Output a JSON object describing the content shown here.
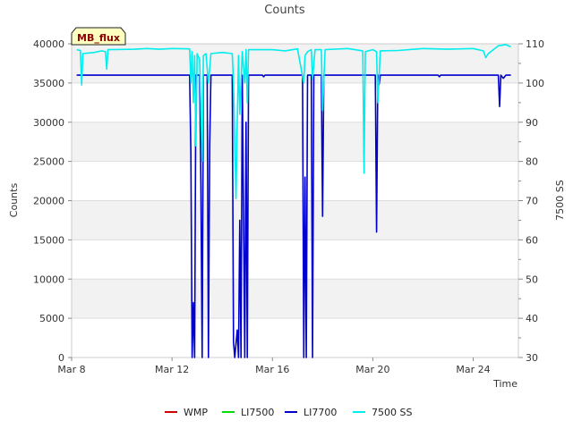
{
  "chart_data": {
    "type": "line",
    "title": "Counts",
    "xlabel": "Time",
    "ylabel": "Counts",
    "y2label": "7500 SS",
    "badge": "MB_flux",
    "ylim": [
      0,
      40000
    ],
    "y2lim": [
      30,
      110
    ],
    "xlim": [
      "2024-03-08",
      "2024-03-25.8"
    ],
    "x_ticks": [
      {
        "date": "2024-03-08",
        "label": "Mar 8"
      },
      {
        "date": "2024-03-12",
        "label": "Mar 12"
      },
      {
        "date": "2024-03-16",
        "label": "Mar 16"
      },
      {
        "date": "2024-03-20",
        "label": "Mar 20"
      },
      {
        "date": "2024-03-24",
        "label": "Mar 24"
      }
    ],
    "y_ticks": [
      {
        "value": 0,
        "label": "0"
      },
      {
        "value": 5000,
        "label": "5000"
      },
      {
        "value": 10000,
        "label": "10000"
      },
      {
        "value": 15000,
        "label": "15000"
      },
      {
        "value": 20000,
        "label": "20000"
      },
      {
        "value": 25000,
        "label": "25000"
      },
      {
        "value": 30000,
        "label": "30000"
      },
      {
        "value": 35000,
        "label": "35000"
      },
      {
        "value": 40000,
        "label": "40000"
      }
    ],
    "y2_ticks": [
      {
        "value": 30,
        "label": "30"
      },
      {
        "value": 40,
        "label": "40"
      },
      {
        "value": 50,
        "label": "50"
      },
      {
        "value": 60,
        "label": "60"
      },
      {
        "value": 70,
        "label": "70"
      },
      {
        "value": 80,
        "label": "80"
      },
      {
        "value": 90,
        "label": "90"
      },
      {
        "value": 100,
        "label": "100"
      },
      {
        "value": 110,
        "label": "110"
      }
    ],
    "legend_position": "bottom",
    "legend": [
      {
        "name": "WMP",
        "color": "#cc0000"
      },
      {
        "name": "LI7500",
        "color": "#00dd00"
      },
      {
        "name": "LI7700",
        "color": "#0000cc"
      },
      {
        "name": "7500 SS",
        "color": "#00eeee"
      }
    ],
    "series": [
      {
        "name": "LI7700",
        "axis": "left",
        "color": "#0000cc",
        "points": [
          [
            "2024-03-08.2",
            36000
          ],
          [
            "2024-03-12.7",
            36000
          ],
          [
            "2024-03-12.75",
            26000
          ],
          [
            "2024-03-12.8",
            0
          ],
          [
            "2024-03-12.85",
            7000
          ],
          [
            "2024-03-12.9",
            0
          ],
          [
            "2024-03-12.95",
            36000
          ],
          [
            "2024-03-13.1",
            36000
          ],
          [
            "2024-03-13.15",
            22000
          ],
          [
            "2024-03-13.2",
            0
          ],
          [
            "2024-03-13.25",
            36000
          ],
          [
            "2024-03-13.4",
            36000
          ],
          [
            "2024-03-13.45",
            0
          ],
          [
            "2024-03-13.5",
            27000
          ],
          [
            "2024-03-13.55",
            36000
          ],
          [
            "2024-03-14.4",
            36000
          ],
          [
            "2024-03-14.45",
            2000
          ],
          [
            "2024-03-14.5",
            0
          ],
          [
            "2024-03-14.6",
            3500
          ],
          [
            "2024-03-14.65",
            0
          ],
          [
            "2024-03-14.7",
            17500
          ],
          [
            "2024-03-14.75",
            0
          ],
          [
            "2024-03-14.8",
            36000
          ],
          [
            "2024-03-14.9",
            0
          ],
          [
            "2024-03-14.95",
            30000
          ],
          [
            "2024-03-15.0",
            0
          ],
          [
            "2024-03-15.05",
            36000
          ],
          [
            "2024-03-15.6",
            36000
          ],
          [
            "2024-03-15.65",
            35800
          ],
          [
            "2024-03-15.7",
            36000
          ],
          [
            "2024-03-17.2",
            36000
          ],
          [
            "2024-03-17.25",
            0
          ],
          [
            "2024-03-17.3",
            23000
          ],
          [
            "2024-03-17.35",
            0
          ],
          [
            "2024-03-17.4",
            36000
          ],
          [
            "2024-03-17.55",
            36000
          ],
          [
            "2024-03-17.6",
            0
          ],
          [
            "2024-03-17.65",
            36000
          ],
          [
            "2024-03-17.95",
            36000
          ],
          [
            "2024-03-18.0",
            18000
          ],
          [
            "2024-03-18.05",
            36000
          ],
          [
            "2024-03-20.1",
            36000
          ],
          [
            "2024-03-20.15",
            16000
          ],
          [
            "2024-03-20.2",
            36000
          ],
          [
            "2024-03-20.25",
            34800
          ],
          [
            "2024-03-20.3",
            36000
          ],
          [
            "2024-03-22.6",
            36000
          ],
          [
            "2024-03-22.65",
            35800
          ],
          [
            "2024-03-22.7",
            36000
          ],
          [
            "2024-03-25.0",
            36000
          ],
          [
            "2024-03-25.05",
            32000
          ],
          [
            "2024-03-25.1",
            36000
          ],
          [
            "2024-03-25.2",
            35600
          ],
          [
            "2024-03-25.3",
            36000
          ],
          [
            "2024-03-25.5",
            36000
          ]
        ]
      },
      {
        "name": "7500 SS",
        "axis": "right",
        "color": "#00eeee",
        "points": [
          [
            "2024-03-08.2",
            108.5
          ],
          [
            "2024-03-08.35",
            108.3
          ],
          [
            "2024-03-08.4",
            99.5
          ],
          [
            "2024-03-08.45",
            107.5
          ],
          [
            "2024-03-08.9",
            107.8
          ],
          [
            "2024-03-09.2",
            108.2
          ],
          [
            "2024-03-09.35",
            108.0
          ],
          [
            "2024-03-09.4",
            103.5
          ],
          [
            "2024-03-09.45",
            108.5
          ],
          [
            "2024-03-10.5",
            108.6
          ],
          [
            "2024-03-11.0",
            108.8
          ],
          [
            "2024-03-11.5",
            108.6
          ],
          [
            "2024-03-12.0",
            108.8
          ],
          [
            "2024-03-12.7",
            108.7
          ],
          [
            "2024-03-12.75",
            100.0
          ],
          [
            "2024-03-12.8",
            108.0
          ],
          [
            "2024-03-12.85",
            95.0
          ],
          [
            "2024-03-12.9",
            107.0
          ],
          [
            "2024-03-12.95",
            84.0
          ],
          [
            "2024-03-13.0",
            107.5
          ],
          [
            "2024-03-13.1",
            106.0
          ],
          [
            "2024-03-13.2",
            80.0
          ],
          [
            "2024-03-13.25",
            107.0
          ],
          [
            "2024-03-13.35",
            107.5
          ],
          [
            "2024-03-13.45",
            100.0
          ],
          [
            "2024-03-13.55",
            107.5
          ],
          [
            "2024-03-14.0",
            107.8
          ],
          [
            "2024-03-14.4",
            107.5
          ],
          [
            "2024-03-14.45",
            100.0
          ],
          [
            "2024-03-14.55",
            70.5
          ],
          [
            "2024-03-14.6",
            90.0
          ],
          [
            "2024-03-14.65",
            107.0
          ],
          [
            "2024-03-14.7",
            92.0
          ],
          [
            "2024-03-14.8",
            108.0
          ],
          [
            "2024-03-14.9",
            100.0
          ],
          [
            "2024-03-14.95",
            108.5
          ],
          [
            "2024-03-15.0",
            95.0
          ],
          [
            "2024-03-15.05",
            108.5
          ],
          [
            "2024-03-16.0",
            108.5
          ],
          [
            "2024-03-16.5",
            108.2
          ],
          [
            "2024-03-17.0",
            108.7
          ],
          [
            "2024-03-17.25",
            100.0
          ],
          [
            "2024-03-17.3",
            107.0
          ],
          [
            "2024-03-17.4",
            108.0
          ],
          [
            "2024-03-17.55",
            108.5
          ],
          [
            "2024-03-17.6",
            101.0
          ],
          [
            "2024-03-17.7",
            108.5
          ],
          [
            "2024-03-17.95",
            108.5
          ],
          [
            "2024-03-18.0",
            93.0
          ],
          [
            "2024-03-18.1",
            108.5
          ],
          [
            "2024-03-19.0",
            108.8
          ],
          [
            "2024-03-19.6",
            108.2
          ],
          [
            "2024-03-19.65",
            77.0
          ],
          [
            "2024-03-19.7",
            108.0
          ],
          [
            "2024-03-20.0",
            108.5
          ],
          [
            "2024-03-20.15",
            108.0
          ],
          [
            "2024-03-20.2",
            95.0
          ],
          [
            "2024-03-20.3",
            108.2
          ],
          [
            "2024-03-21.0",
            108.3
          ],
          [
            "2024-03-22.0",
            108.8
          ],
          [
            "2024-03-23.0",
            108.6
          ],
          [
            "2024-03-24.0",
            108.8
          ],
          [
            "2024-03-24.4",
            108.2
          ],
          [
            "2024-03-24.5",
            106.5
          ],
          [
            "2024-03-24.6",
            107.5
          ],
          [
            "2024-03-25.0",
            109.5
          ],
          [
            "2024-03-25.3",
            109.8
          ],
          [
            "2024-03-25.5",
            109.2
          ]
        ]
      }
    ]
  }
}
